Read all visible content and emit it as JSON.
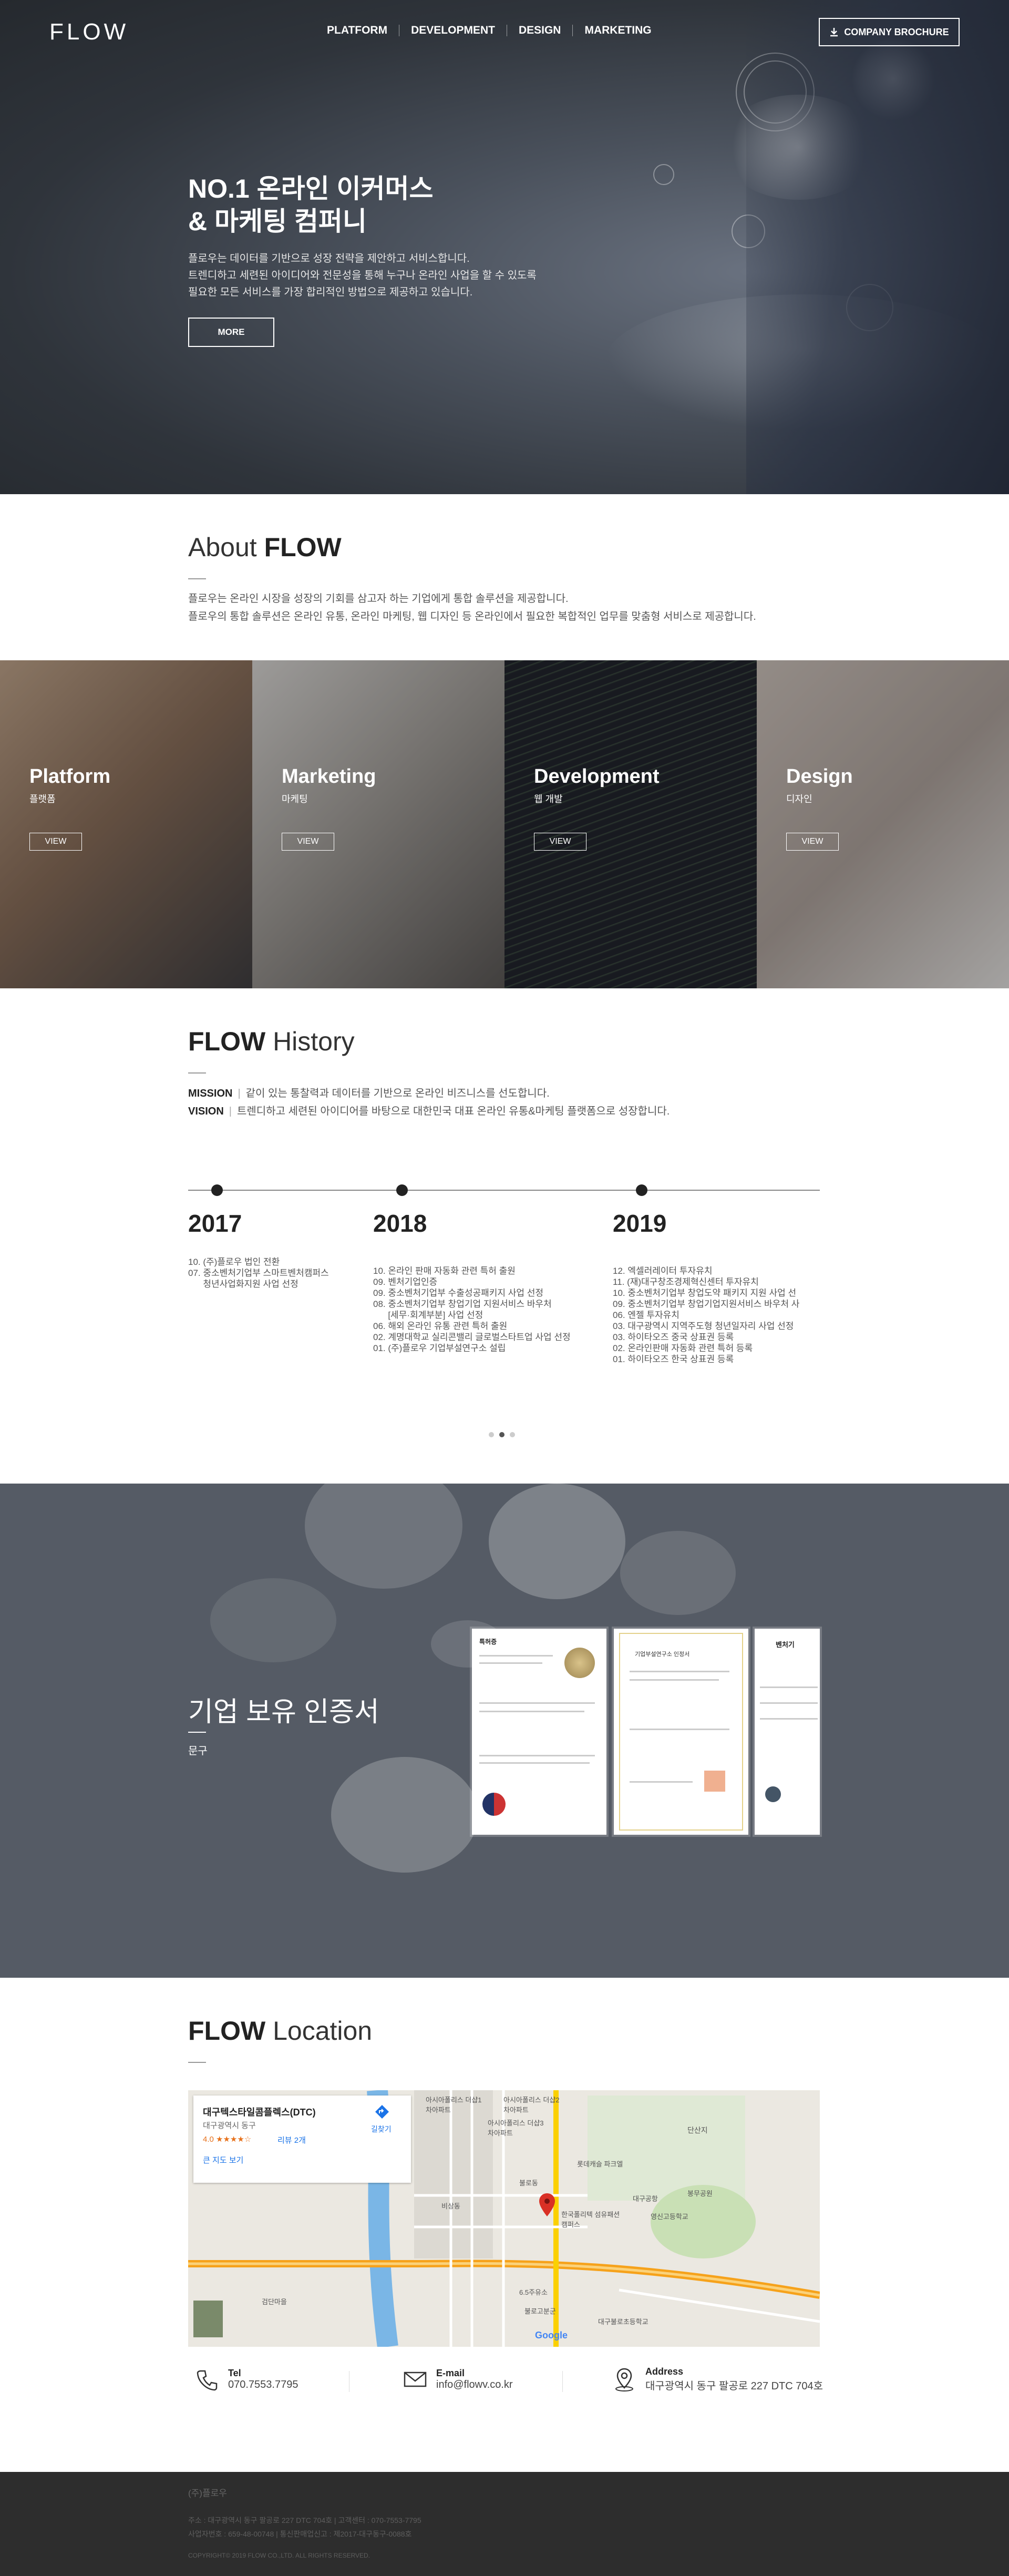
{
  "header": {
    "logo": "FLOW",
    "nav": [
      "PLATFORM",
      "DEVELOPMENT",
      "DESIGN",
      "MARKETING"
    ],
    "brochure_label": "COMPANY BROCHURE"
  },
  "hero": {
    "title_line1": "NO.1 온라인 이커머스",
    "title_line2": "& 마케팅 컴퍼니",
    "desc_line1": "플로우는 데이터를 기반으로 성장 전략을 제안하고 서비스합니다.",
    "desc_line2": "트렌디하고 세련된 아이디어와 전문성을 통해 누구나 온라인 사업을 할 수 있도록",
    "desc_line3": "필요한 모든 서비스를 가장 합리적인 방법으로 제공하고 있습니다.",
    "more_label": "MORE"
  },
  "about": {
    "title_light": "About",
    "title_bold": "FLOW",
    "desc_line1": "플로우는 온라인 시장을 성장의 기회를 삼고자 하는 기업에게 통합 솔루션을 제공합니다.",
    "desc_line2": "플로우의 통합 솔루션은 온라인 유통, 온라인 마케팅, 웹 디자인 등 온라인에서 필요한 복합적인 업무를 맞춤형 서비스로 제공합니다."
  },
  "services": [
    {
      "name": "Platform",
      "sub": "플랫폼",
      "view": "VIEW"
    },
    {
      "name": "Marketing",
      "sub": "마케팅",
      "view": "VIEW"
    },
    {
      "name": "Development",
      "sub": "웹 개발",
      "view": "VIEW"
    },
    {
      "name": "Design",
      "sub": "디자인",
      "view": "VIEW"
    }
  ],
  "history": {
    "title_bold": "FLOW",
    "title_light": "History",
    "mission_label": "MISSION",
    "mission_text": "같이 있는 통찰력과 데이터를 기반으로 온라인 비즈니스를 선도합니다.",
    "vision_label": "VISION",
    "vision_text": "트렌디하고 세련된 아이디어를 바탕으로 대한민국 대표 온라인 유통&마케팅 플랫폼으로 성장합니다.",
    "years": [
      {
        "year": "2017",
        "events": [
          "10. (주)플로우 법인 전환",
          "07. 중소벤처기업부 스마트벤처캠퍼스\n      청년사업화지원 사업 선정"
        ]
      },
      {
        "year": "2018",
        "events": [
          "10. 온라인 판매 자동화 관련 특허 출원",
          "09. 벤처기업인증",
          "09. 중소벤처기업부 수출성공패키지 사업 선정",
          "08. 중소벤처기업부 창업기업 지원서비스 바우처\n      [세무·회계부분] 사업 선정",
          "06. 해외 온라인 유통 관련 특허 출원",
          "02. 계명대학교 실리콘밸리 글로벌스타트업 사업 선정",
          "01. (주)플로우 기업부설연구소 설립"
        ]
      },
      {
        "year": "2019",
        "events": [
          "12. 엑셀러레이터 투자유치",
          "11. (재)대구창조경제혁신센터 투자유치",
          "10. 중소벤처기업부 창업도약 패키지 지원 사업 선",
          "09. 중소벤처기업부 창업기업지원서비스 바우처 사",
          "06. 엔젤 투자유치",
          "03. 대구광역시 지역주도형 청년일자리 사업 선정",
          "03. 하이타오즈 중국 상표권 등록",
          "02. 온라인판매 자동화 관련 특허 등록",
          "01. 하이타오즈 한국 상표권 등록"
        ]
      }
    ]
  },
  "cert": {
    "title": "기업 보유 인증서",
    "sub": "문구",
    "doc1_heading": "특허증",
    "doc2_heading": "기업부설연구소 인정서",
    "doc3_heading": "벤처기"
  },
  "location": {
    "title_bold": "FLOW",
    "title_light": "Location",
    "card": {
      "place": "대구텍스타일콤플렉스(DTC)",
      "area": "대구광역시 동구",
      "rating": "4.0 ★★★★☆",
      "reviews": "리뷰 2개",
      "directions": "길찾기",
      "bigmap": "큰 지도 보기"
    },
    "map_labels": [
      "아시아폴리스 더샵1차아파트",
      "아시아폴리스 더샵2차아파트",
      "아시아폴리스 더샵3차아파트",
      "단산지",
      "롯데캐슬 파크엘",
      "불로동",
      "대구공항",
      "비상동",
      "한국폴리텍 섬유패션캠퍼스",
      "영신고등학교",
      "봉무공원",
      "6.5주유소",
      "대구불로초등학교",
      "불로고분군",
      "검단마을",
      "Google"
    ],
    "contacts": [
      {
        "label": "Tel",
        "value": "070.7553.7795",
        "icon": "phone-icon"
      },
      {
        "label": "E-mail",
        "value": "info@flowv.co.kr",
        "icon": "mail-icon"
      },
      {
        "label": "Address",
        "value": "대구광역시 동구 팔공로 227 DTC 704호",
        "icon": "location-icon"
      }
    ]
  },
  "footer": {
    "company": "(주)플로우",
    "line1": "주소 : 대구광역시 동구 팔공로 227 DTC 704호  |  고객센터 : 070-7553-7795",
    "line2": "사업자번호 : 659-48-00748  |  통신판매업신고 : 제2017-대구동구-0088호",
    "line3": "COPYRIGHT© 2019 FLOW CO.,LTD. ALL RIGHTS RESERVED."
  },
  "colors": {
    "hero_bg": "#3a3f46",
    "footer_bg": "#2d2d2d",
    "cert_bg": "#555b65",
    "pin": "#d93025",
    "road": "#f6a21b",
    "river": "#4ea3e0"
  }
}
